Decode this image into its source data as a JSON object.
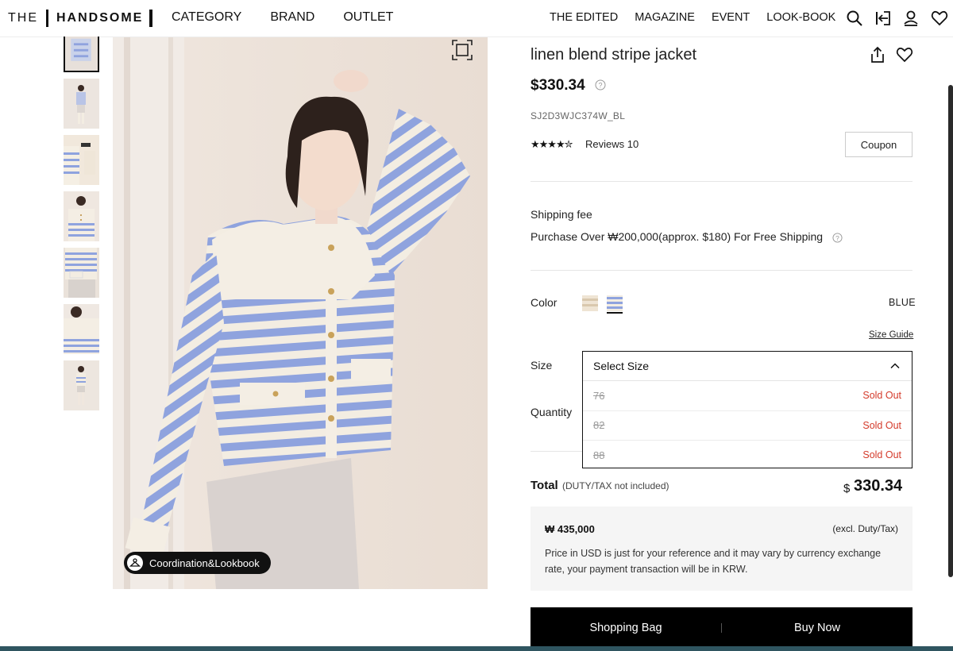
{
  "header": {
    "logo_the": "THE",
    "logo_brand": "HANDSOME",
    "nav_left": [
      "CATEGORY",
      "BRAND",
      "OUTLET"
    ],
    "nav_right": [
      "THE EDITED",
      "MAGAZINE",
      "EVENT",
      "LOOK-BOOK"
    ],
    "icons": [
      "search-icon",
      "logout-icon",
      "account-icon",
      "wishlist-icon"
    ]
  },
  "gallery": {
    "coordination_label": "Coordination&Lookbook",
    "thumbnail_count": 7,
    "active_thumbnail": 1
  },
  "product": {
    "title": "linen blend stripe jacket",
    "price": "$330.34",
    "sku": "SJ2D3WJC374W_BL",
    "stars": "★★★★✮",
    "rating": 4.5,
    "reviews_label": "Reviews 10",
    "coupon_label": "Coupon"
  },
  "shipping": {
    "label": "Shipping fee",
    "text": "Purchase Over ₩200,000(approx. $180) For Free Shipping"
  },
  "color": {
    "label": "Color",
    "value": "BLUE",
    "swatches": [
      "beige-stripe",
      "blue-stripe"
    ],
    "selected": "blue-stripe"
  },
  "size": {
    "label": "Size",
    "guide_label": "Size Guide",
    "placeholder": "Select Size",
    "options": [
      {
        "size": "76",
        "status": "Sold Out"
      },
      {
        "size": "82",
        "status": "Sold Out"
      },
      {
        "size": "88",
        "status": "Sold Out"
      }
    ]
  },
  "quantity": {
    "label": "Quantity"
  },
  "total": {
    "label": "Total",
    "note": "(DUTY/TAX not included)",
    "currency": "$",
    "value": "330.34"
  },
  "notice": {
    "krw": "₩ 435,000",
    "excl": "(excl. Duty/Tax)",
    "text": "Price in USD is just for your reference and it may vary by currency exchange rate, your payment transaction will be in KRW."
  },
  "actions": {
    "bag_label": "Shopping Bag",
    "buy_label": "Buy Now"
  },
  "colors": {
    "accent": "#111111",
    "sold_out": "#d43a2a",
    "stripe_blue": "#8fa3de",
    "stripe_cream": "#f3ede2",
    "action_bar": "#000000"
  }
}
